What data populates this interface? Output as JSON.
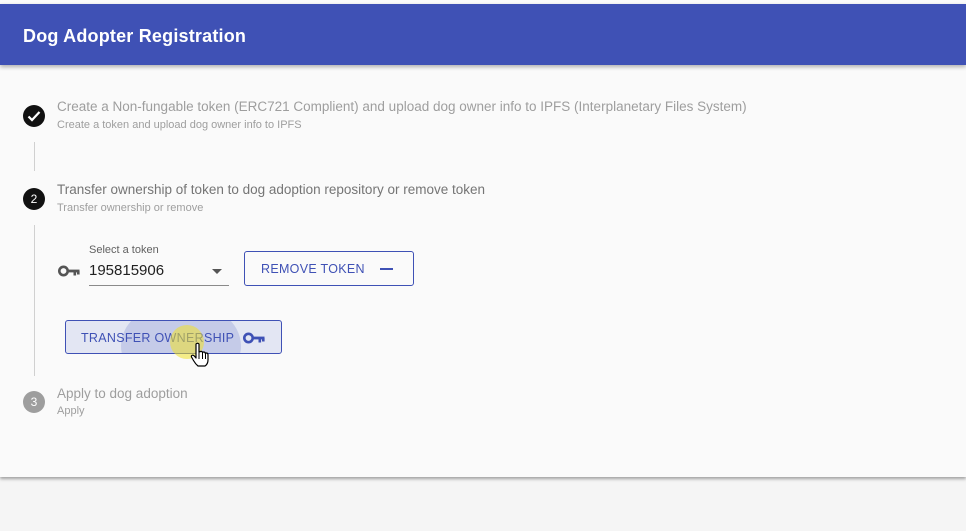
{
  "app": {
    "title": "Dog Adopter Registration"
  },
  "steps": [
    {
      "number": "1",
      "state": "completed",
      "label": "Create a Non-fungable token (ERC721 Complient) and upload dog owner info to IPFS (Interplanetary Files System)",
      "sublabel": "Create a token and upload dog owner info to IPFS"
    },
    {
      "number": "2",
      "state": "active",
      "label": "Transfer ownership of token to dog adoption repository or remove token",
      "sublabel": "Transfer ownership or remove"
    },
    {
      "number": "3",
      "state": "pending",
      "label": "Apply to dog adoption",
      "sublabel": "Apply"
    }
  ],
  "token_select": {
    "caption": "Select a token",
    "value": "195815906",
    "icon": "key-icon"
  },
  "buttons": {
    "remove": {
      "label": "REMOVE TOKEN",
      "icon": "minus-icon"
    },
    "transfer": {
      "label": "TRANSFER OWNERSHIP",
      "icon": "key-icon"
    }
  },
  "colors": {
    "primary": "#3f51b5",
    "step_active": "#111111",
    "step_pending": "#9e9e9e"
  }
}
